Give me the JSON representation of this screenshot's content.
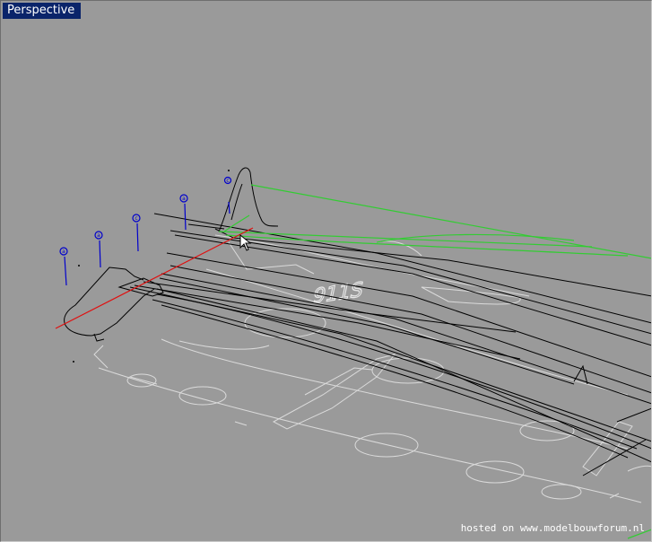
{
  "viewport": {
    "title": "Perspective",
    "background_color": "#9a9a9a",
    "title_bar_color": "#0a246a"
  },
  "scene": {
    "curve_color": "#000000",
    "texture_color": "#e6e6e6",
    "construction_curve_color": "#33cc33",
    "axis_color": "#e01010",
    "point_marker_color": "#0000cc",
    "point_marker_labels": [
      "a",
      "a",
      "c",
      "a",
      "c"
    ],
    "decal_text": "911S"
  },
  "watermark": {
    "text": "hosted on www.modelbouwforum.nl"
  }
}
